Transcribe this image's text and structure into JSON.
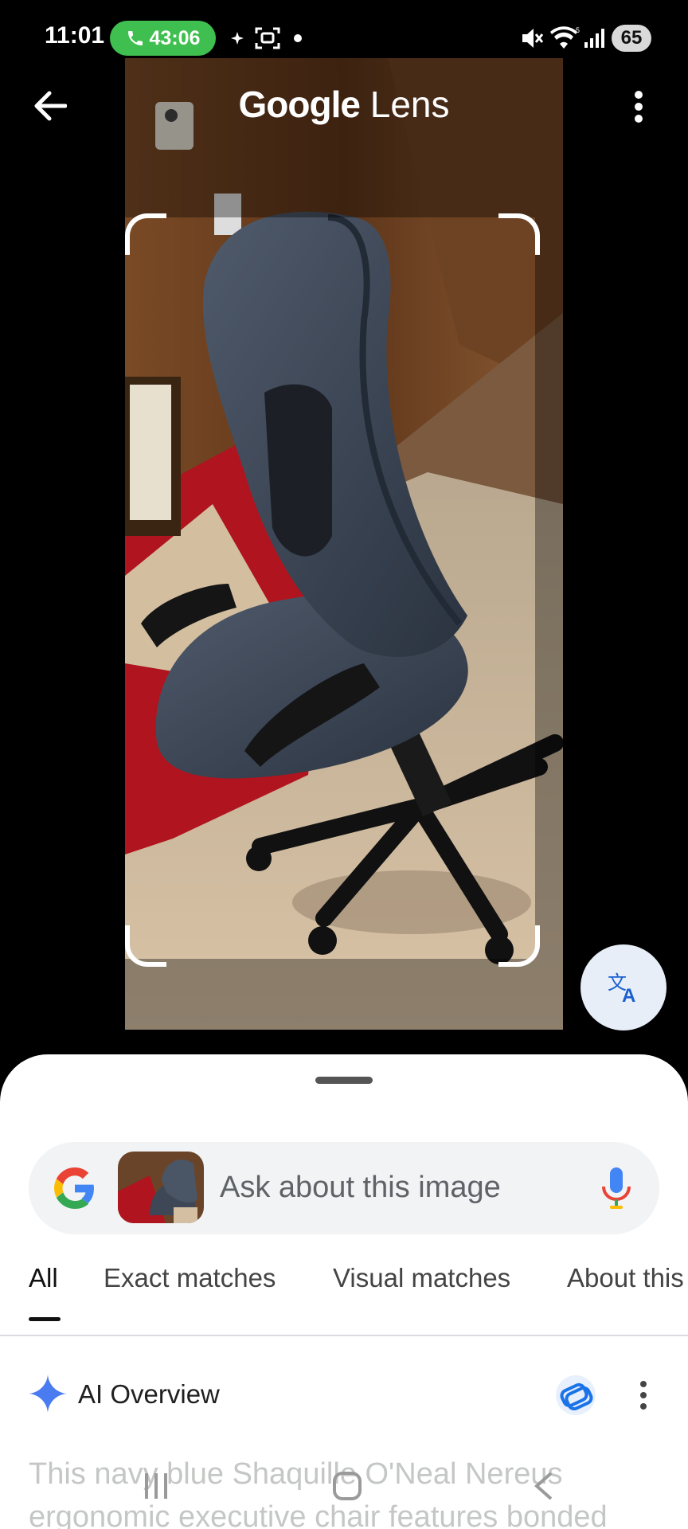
{
  "status_bar": {
    "time": "11:01",
    "call_timer": "43:06",
    "battery": "65",
    "icons": [
      "phone-icon",
      "sparkle-icon",
      "screenshot-icon",
      "dot-icon",
      "mute-icon",
      "wifi-icon",
      "signal-icon"
    ]
  },
  "header": {
    "title_brand": "Google",
    "title_product": "Lens",
    "back_icon": "arrow-left-icon",
    "more_icon": "more-vert-icon"
  },
  "translate_button": {
    "icon": "translate-icon"
  },
  "search": {
    "placeholder": "Ask about this image",
    "logo": "google-g-logo",
    "mic_icon": "mic-icon"
  },
  "tabs": [
    {
      "label": "All",
      "active": true
    },
    {
      "label": "Exact matches",
      "active": false
    },
    {
      "label": "Visual matches",
      "active": false
    },
    {
      "label": "About this",
      "active": false
    }
  ],
  "ai_overview": {
    "title": "AI Overview",
    "text": "This navy blue Shaquille O'Neal Nereus ergonomic executive chair features bonded"
  },
  "colors": {
    "accent_blue": "#1a73e8",
    "call_green": "#3fbf4f",
    "sheet_bg": "#ffffff"
  }
}
